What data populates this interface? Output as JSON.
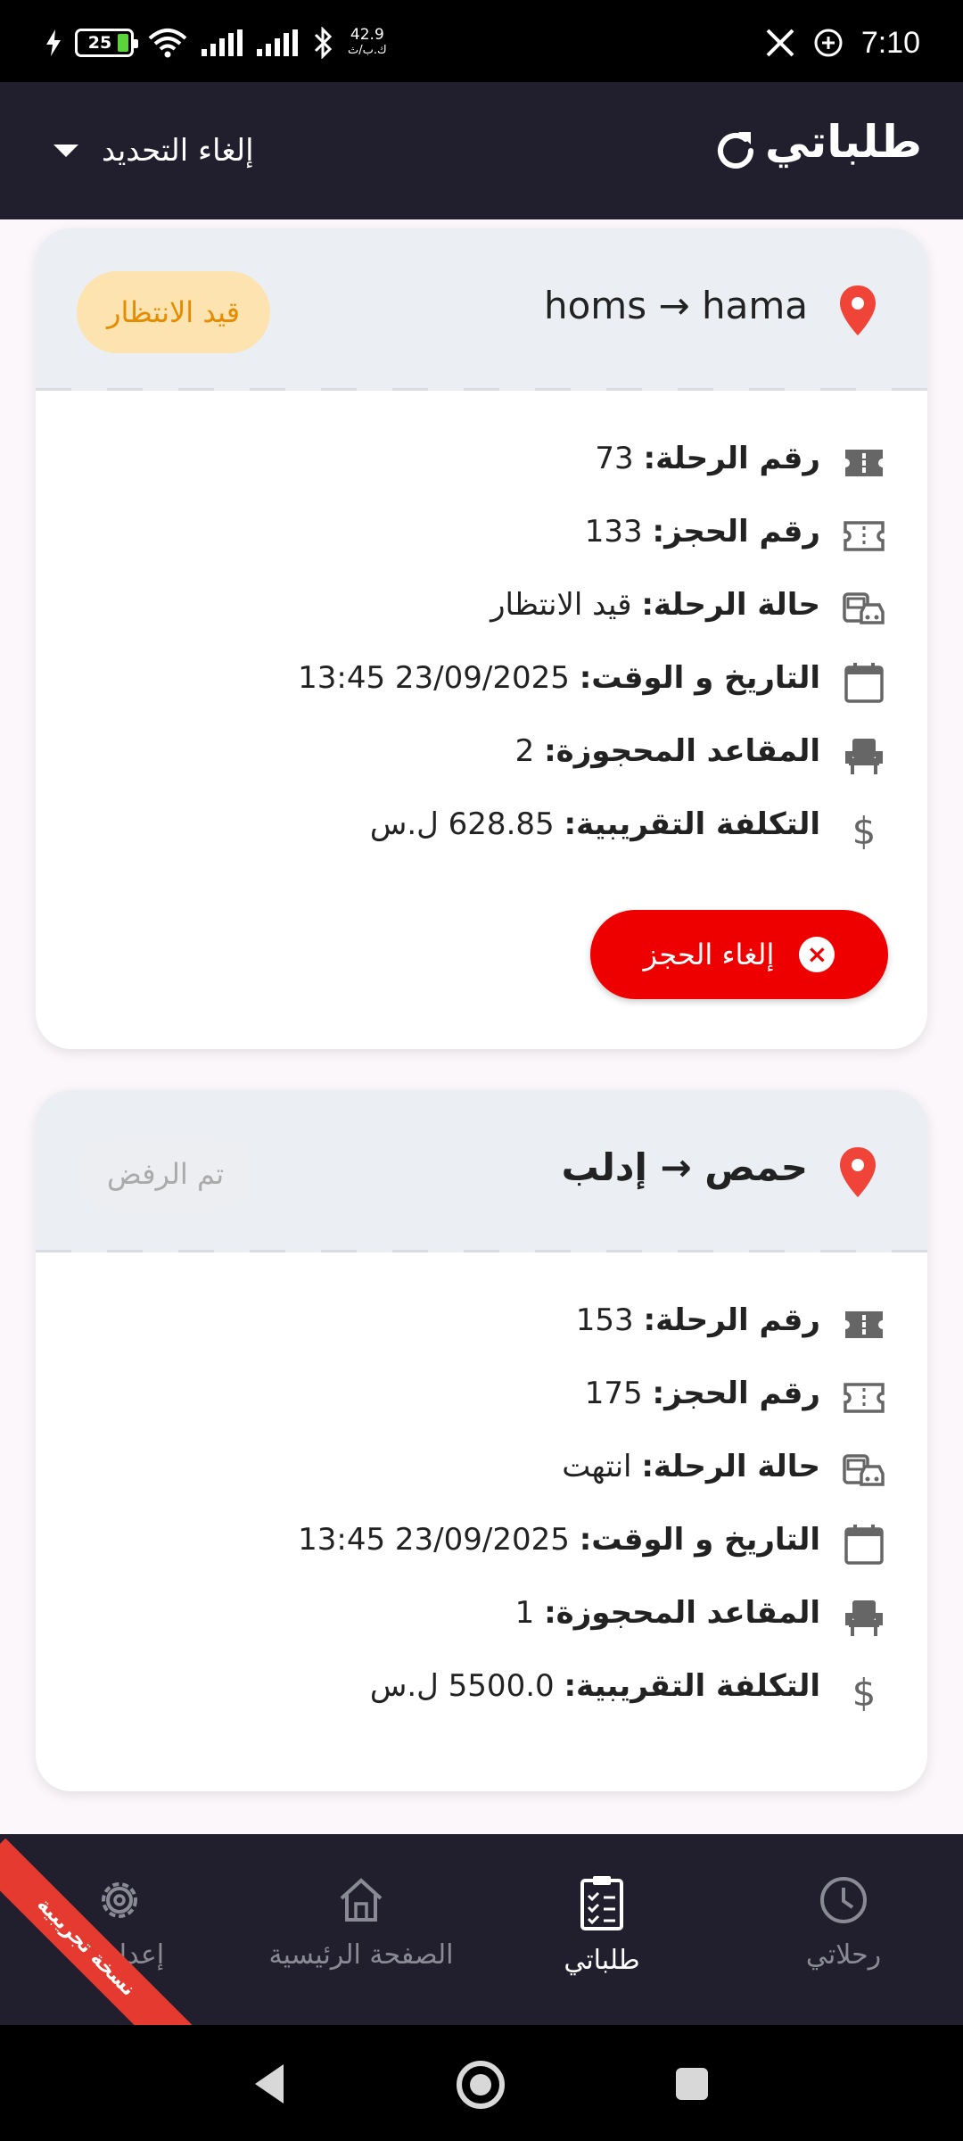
{
  "status_bar": {
    "battery": "25",
    "net_speed_value": "42.9",
    "net_speed_unit": "ك.ب/ث",
    "time": "7:10"
  },
  "app_bar": {
    "title": "طلباتي",
    "filter_label": "إلغاء التحديد"
  },
  "labels": {
    "trip_number": "رقم الرحلة:",
    "booking_number": "رقم الحجز:",
    "trip_status": "حالة الرحلة:",
    "date_time": "التاريخ و الوقت:",
    "seats": "المقاعد المحجوزة:",
    "cost": "التكلفة التقريبية:"
  },
  "requests": [
    {
      "route": "homs → hama",
      "badge": "قيد الانتظار",
      "trip_number": "73",
      "booking_number": "133",
      "trip_status": "قيد الانتظار",
      "date_time": "23/09/2025 13:45",
      "seats": "2",
      "cost": "628.85 ل.س",
      "cancel_label": "إلغاء الحجز"
    },
    {
      "route": "حمص → إدلب",
      "badge": "تم الرفض",
      "trip_number": "153",
      "booking_number": "175",
      "trip_status": "انتهت",
      "date_time": "23/09/2025 13:45",
      "seats": "1",
      "cost": "5500.0 ل.س"
    }
  ],
  "bottom_nav": {
    "items": [
      {
        "label": "إعدادات"
      },
      {
        "label": "الصفحة الرئيسية"
      },
      {
        "label": "طلباتي"
      },
      {
        "label": "رحلاتي"
      }
    ],
    "active": "طلباتي"
  },
  "ribbon": "نسخة تجريبية",
  "colors": {
    "app_bar": "#211f2e",
    "accent_red": "#ee0000",
    "pending_bg": "#fde3b0",
    "pending_text": "#e58c00",
    "pin": "#f04438"
  }
}
